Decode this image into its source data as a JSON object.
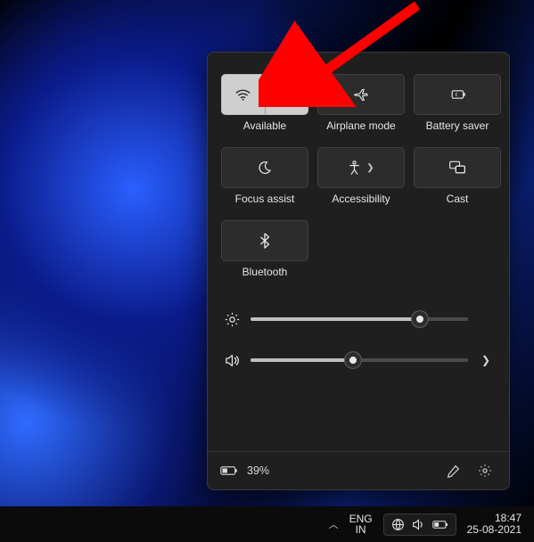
{
  "panel": {
    "tiles": [
      {
        "id": "wifi",
        "label": "Available",
        "active": true,
        "split": true
      },
      {
        "id": "airplane",
        "label": "Airplane mode"
      },
      {
        "id": "battery-saver",
        "label": "Battery saver"
      },
      {
        "id": "focus-assist",
        "label": "Focus assist"
      },
      {
        "id": "accessibility",
        "label": "Accessibility",
        "chevron": true
      },
      {
        "id": "cast",
        "label": "Cast"
      },
      {
        "id": "bluetooth",
        "label": "Bluetooth"
      }
    ],
    "brightness_percent": 78,
    "volume_percent": 47,
    "battery_text": "39%"
  },
  "taskbar": {
    "lang_line1": "ENG",
    "lang_line2": "IN",
    "time": "18:47",
    "date": "25-08-2021"
  },
  "annotation": {
    "target": "wifi-expand"
  }
}
